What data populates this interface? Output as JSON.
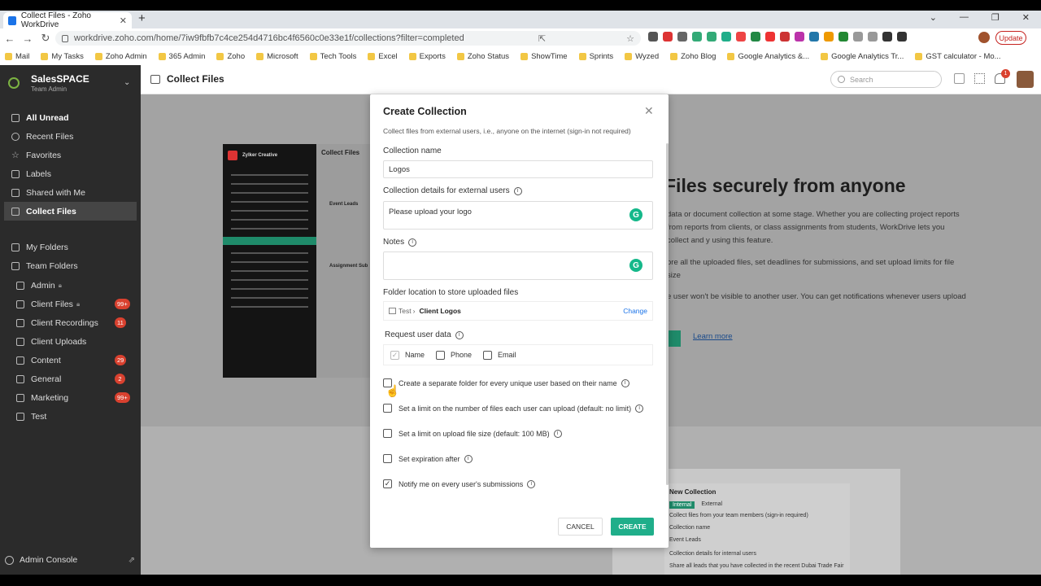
{
  "browser": {
    "tab_title": "Collect Files - Zoho WorkDrive",
    "url": "workdrive.zoho.com/home/7iw9fbfb7c4ce254d4716bc4f6560c0e33e1f/collections?filter=completed",
    "update_label": "Update",
    "bookmarks": [
      "Mail",
      "My Tasks",
      "Zoho Admin",
      "365 Admin",
      "Zoho",
      "Microsoft",
      "Tech Tools",
      "Excel",
      "Exports",
      "Zoho Status",
      "ShowTime",
      "Sprints",
      "Wyzed",
      "Zoho Blog",
      "Google Analytics &...",
      "Google Analytics Tr...",
      "GST calculator - Mo..."
    ]
  },
  "sidebar": {
    "org_name": "SalesSPACE",
    "org_role": "Team Admin",
    "items": [
      {
        "label": "All Unread"
      },
      {
        "label": "Recent Files"
      },
      {
        "label": "Favorites"
      },
      {
        "label": "Labels"
      },
      {
        "label": "Shared with Me"
      },
      {
        "label": "Collect Files"
      }
    ],
    "my_folders": "My Folders",
    "team_folders": "Team Folders",
    "team_items": [
      {
        "label": "Admin",
        "badge": ""
      },
      {
        "label": "Client Files",
        "badge": "99+"
      },
      {
        "label": "Client Recordings",
        "badge": "11"
      },
      {
        "label": "Client Uploads",
        "badge": ""
      },
      {
        "label": "Content",
        "badge": "29"
      },
      {
        "label": "General",
        "badge": "2"
      },
      {
        "label": "Marketing",
        "badge": "99+"
      },
      {
        "label": "Test",
        "badge": ""
      }
    ],
    "admin_console": "Admin Console"
  },
  "header": {
    "title": "Collect Files",
    "search_placeholder": "Search",
    "notif_count": "1"
  },
  "hero": {
    "title": "Files securely from anyone",
    "para1": "data or document collection at some stage. Whether you are collecting project reports from reports from clients, or class assignments from students, WorkDrive lets you collect and y using this feature.",
    "para2": "ore all the uploaded files, set deadlines for submissions, and set upload limits for file size",
    "para3": "e user won't be visible to another user. You can get notifications whenever users upload",
    "learn_more": "Learn more"
  },
  "preview": {
    "org": "Zylker Creative",
    "page": "Collect Files",
    "card1": "Event Leads",
    "card2": "Assignment Sub",
    "new_collection": "New Collection",
    "internal": "Internal",
    "external": "External",
    "sub": "Collect files from your team members (sign-in required)",
    "collection_name": "Collection name",
    "event_leads": "Event Leads",
    "details": "Collection details for internal users",
    "share": "Share all leads that you have collected in the recent Dubai Trade Fair"
  },
  "modal": {
    "title": "Create Collection",
    "subtitle": "Collect files from external users, i.e., anyone on the internet (sign-in not required)",
    "name_label": "Collection name",
    "name_value": "Logos",
    "details_label": "Collection details for external users",
    "details_value": "Please upload your logo",
    "notes_label": "Notes",
    "notes_value": "",
    "folder_label": "Folder location to store uploaded files",
    "folder_parent": "Test",
    "folder_child": "Client Logos",
    "change_label": "Change",
    "request_label": "Request user data",
    "fields": [
      {
        "label": "Name",
        "checked": true
      },
      {
        "label": "Phone",
        "checked": false
      },
      {
        "label": "Email",
        "checked": false
      }
    ],
    "options": [
      {
        "label": "Create a separate folder for every unique user based on their name",
        "checked": false
      },
      {
        "label": "Set a limit on the number of files each user can upload (default: no limit)",
        "checked": false
      },
      {
        "label": "Set a limit on upload file size (default: 100 MB)",
        "checked": false
      },
      {
        "label": "Set expiration after",
        "checked": false
      },
      {
        "label": "Notify me on every user's submissions",
        "checked": true
      }
    ],
    "cancel_label": "CANCEL",
    "create_label": "CREATE"
  },
  "colors": {
    "accent": "#1fae8a",
    "badge": "#d9412f",
    "sidebar": "#2b2b2b"
  }
}
